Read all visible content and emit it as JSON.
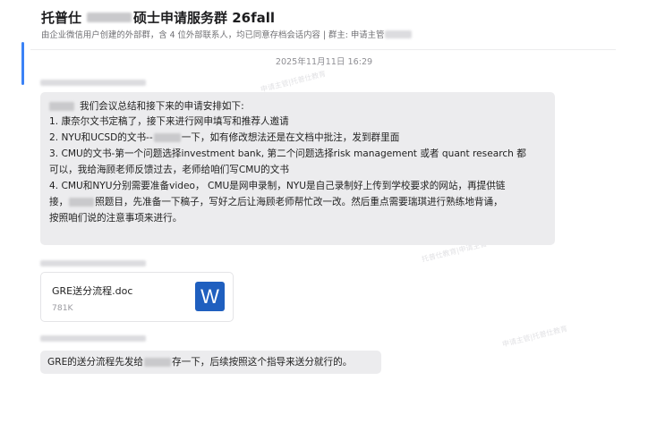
{
  "header": {
    "title_prefix": "托普仕",
    "title_suffix": "硕士申请服务群 26fall",
    "subtitle_text": "由企业微信用户创建的外部群，含 4 位外部联系人，均已同意存档会话内容 | 群主: 申请主管"
  },
  "timestamp": "2025年11月11日 16:29",
  "messages": {
    "msg1": {
      "line1": "我们会议总结和接下来的申请安排如下:",
      "line2": "1. 康奈尔文书定稿了，接下来进行网申填写和推荐人邀请",
      "line3a": "2. NYU和UCSD的文书--",
      "line3b": "一下，如有修改想法还是在文档中批注，发到群里面",
      "line4": "3. CMU的文书-第一个问题选择investment bank, 第二个问题选择risk management 或者 quant research 都",
      "line5": "可以，我给海顾老师反馈过去，老师给咱们写CMU的文书",
      "line6": "4. CMU和NYU分别需要准备video， CMU是网申录制，NYU是自己录制好上传到学校要求的网站，再提供链",
      "line7a": "接，",
      "line7b": "照题目，先准备一下稿子，写好之后让海顾老师帮忙改一改。然后重点需要瑞琪进行熟练地背诵，",
      "line8": "按照咱们说的注意事项来进行。"
    },
    "file": {
      "name": "GRE送分流程.doc",
      "size": "781K",
      "icon": "word-doc-icon",
      "icon_letter": "W",
      "icon_color": "#1f5fbf"
    },
    "msg2": {
      "text_a": "GRE的送分流程先发给",
      "text_b": "存一下，后续按照这个指导来送分就行的。"
    }
  },
  "colors": {
    "bubble": "#ececee",
    "accent": "#3b82f6"
  }
}
